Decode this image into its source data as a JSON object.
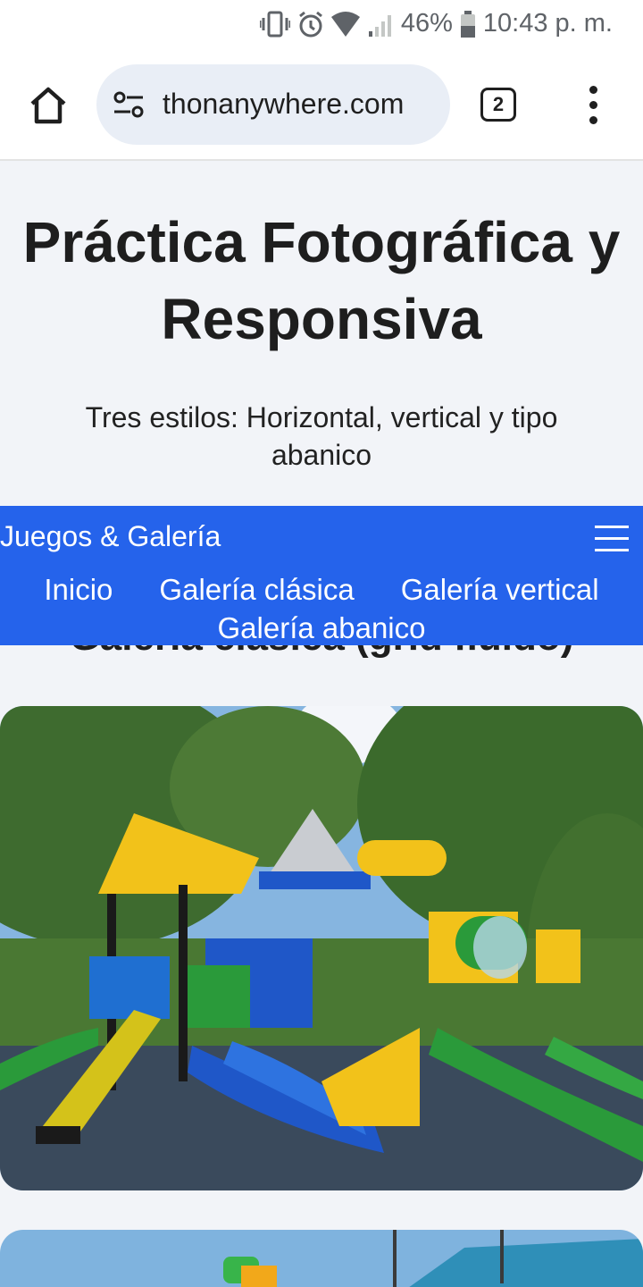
{
  "status_bar": {
    "battery": "46%",
    "time": "10:43 p. m."
  },
  "browser": {
    "url": "thonanywhere.com",
    "tab_count": "2",
    "icons": [
      "home-icon",
      "site-settings-icon",
      "tabs-icon",
      "more-vert-icon"
    ]
  },
  "page": {
    "title": "Práctica Fotográfica y Responsiva",
    "subtitle": "Tres estilos: Horizontal, vertical y tipo abanico",
    "section_heading": "Galería clásica (grid fluido)"
  },
  "navbar": {
    "brand": "Juegos & Galería",
    "links": [
      "Inicio",
      "Galería clásica",
      "Galería vertical",
      "Galería abanico"
    ],
    "color": "#2563eb"
  }
}
